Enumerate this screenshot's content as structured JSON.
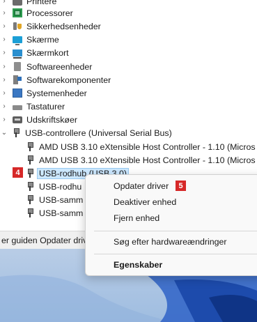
{
  "device_tree": {
    "items": [
      {
        "label": "Printere",
        "icon": "printer-icon",
        "expanded": false
      },
      {
        "label": "Processorer",
        "icon": "processor-icon",
        "expanded": false
      },
      {
        "label": "Sikkerhedsenheder",
        "icon": "security-device-icon",
        "expanded": false
      },
      {
        "label": "Skærme",
        "icon": "monitor-icon",
        "expanded": false
      },
      {
        "label": "Skærmkort",
        "icon": "display-adapter-icon",
        "expanded": false
      },
      {
        "label": "Softwareenheder",
        "icon": "software-device-icon",
        "expanded": false
      },
      {
        "label": "Softwarekomponenter",
        "icon": "software-component-icon",
        "expanded": false
      },
      {
        "label": "Systemenheder",
        "icon": "system-device-icon",
        "expanded": false
      },
      {
        "label": "Tastaturer",
        "icon": "keyboard-icon",
        "expanded": false
      },
      {
        "label": "Udskriftskøer",
        "icon": "print-queue-icon",
        "expanded": false
      },
      {
        "label": "USB-controllere (Universal Serial Bus)",
        "icon": "usb-icon",
        "expanded": true
      }
    ],
    "usb_children": [
      {
        "label": "AMD USB 3.10 eXtensible Host Controller - 1.10 (Micros",
        "icon": "usb-device-icon",
        "selected": false
      },
      {
        "label": "AMD USB 3.10 eXtensible Host Controller - 1.10 (Micros",
        "icon": "usb-device-icon",
        "selected": false
      },
      {
        "label": "USB-rodhub (USB 3.0)",
        "icon": "usb-device-icon",
        "selected": true
      },
      {
        "label": "USB-rodhu",
        "icon": "usb-device-icon",
        "selected": false
      },
      {
        "label": "USB-samm",
        "icon": "usb-device-icon",
        "selected": false
      },
      {
        "label": "USB-samm",
        "icon": "usb-device-icon",
        "selected": false
      }
    ]
  },
  "status_bar": {
    "text": "er guiden Opdater driv"
  },
  "context_menu": {
    "items": [
      {
        "label": "Opdater driver",
        "bold": false
      },
      {
        "label": "Deaktiver enhed",
        "bold": false
      },
      {
        "label": "Fjern enhed",
        "bold": false
      },
      {
        "label": "Søg efter hardwareændringer",
        "bold": false
      },
      {
        "label": "Egenskaber",
        "bold": true
      }
    ]
  },
  "annotations": {
    "badge_tree": "4",
    "badge_menu": "5",
    "badge_color": "#d62828"
  },
  "colors": {
    "selection": "#cce8ff",
    "selection_border": "#99c9ef",
    "menu_bg": "#f9f9f9"
  }
}
